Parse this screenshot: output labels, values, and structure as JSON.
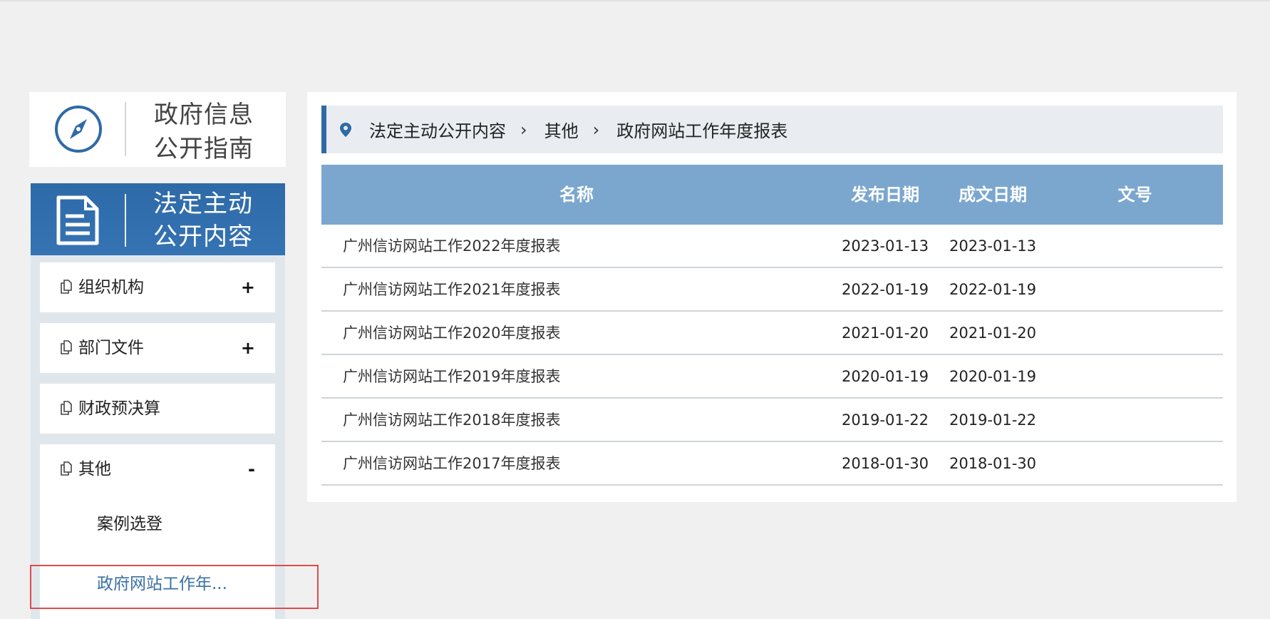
{
  "sidebar": {
    "guide_title_line1": "政府信息",
    "guide_title_line2": "公开指南",
    "section_title_line1": "法定主动",
    "section_title_line2": "公开内容",
    "items": [
      {
        "label": "组织机构",
        "toggle": "+"
      },
      {
        "label": "部门文件",
        "toggle": "+"
      },
      {
        "label": "财政预决算",
        "toggle": ""
      },
      {
        "label": "其他",
        "toggle": "-"
      }
    ],
    "sub_items": [
      {
        "label": "案例选登"
      },
      {
        "label": "政府网站工作年..."
      }
    ]
  },
  "breadcrumb": {
    "items": [
      "法定主动公开内容",
      "其他",
      "政府网站工作年度报表"
    ],
    "separator": "›"
  },
  "table": {
    "headers": {
      "name": "名称",
      "published": "发布日期",
      "written": "成文日期",
      "doc_no": "文号"
    },
    "rows": [
      {
        "name": "广州信访网站工作2022年度报表",
        "published": "2023-01-13",
        "written": "2023-01-13",
        "doc_no": ""
      },
      {
        "name": "广州信访网站工作2021年度报表",
        "published": "2022-01-19",
        "written": "2022-01-19",
        "doc_no": ""
      },
      {
        "name": "广州信访网站工作2020年度报表",
        "published": "2021-01-20",
        "written": "2021-01-20",
        "doc_no": ""
      },
      {
        "name": "广州信访网站工作2019年度报表",
        "published": "2020-01-19",
        "written": "2020-01-19",
        "doc_no": ""
      },
      {
        "name": "广州信访网站工作2018年度报表",
        "published": "2019-01-22",
        "written": "2019-01-22",
        "doc_no": ""
      },
      {
        "name": "广州信访网站工作2017年度报表",
        "published": "2018-01-30",
        "written": "2018-01-30",
        "doc_no": ""
      }
    ]
  },
  "colors": {
    "primary": "#2f6aa6",
    "table_header": "#7ba7cf",
    "active_link": "#3a70a6",
    "highlight_border": "#e04a4a"
  }
}
